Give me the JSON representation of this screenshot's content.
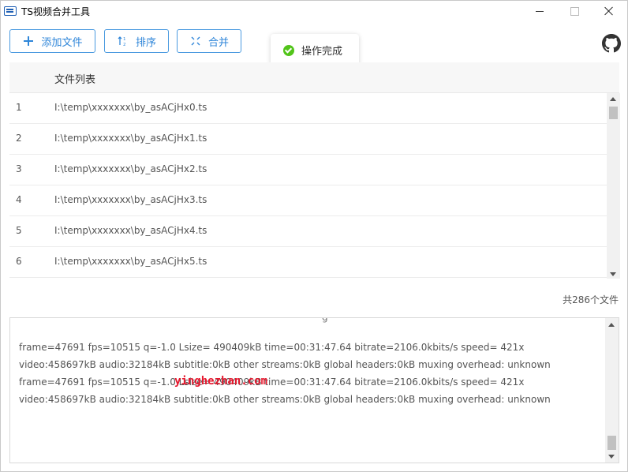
{
  "window": {
    "title": "TS视频合并工具"
  },
  "toolbar": {
    "add_label": "添加文件",
    "sort_label": "排序",
    "merge_label": "合并"
  },
  "toast": {
    "message": "操作完成"
  },
  "table": {
    "column_header": "文件列表",
    "rows": [
      {
        "index": "1",
        "path": "I:\\temp\\xxxxxxx\\by_asACjHx0.ts"
      },
      {
        "index": "2",
        "path": "I:\\temp\\xxxxxxx\\by_asACjHx1.ts"
      },
      {
        "index": "3",
        "path": "I:\\temp\\xxxxxxx\\by_asACjHx2.ts"
      },
      {
        "index": "4",
        "path": "I:\\temp\\xxxxxxx\\by_asACjHx3.ts"
      },
      {
        "index": "5",
        "path": "I:\\temp\\xxxxxxx\\by_asACjHx4.ts"
      },
      {
        "index": "6",
        "path": "I:\\temp\\xxxxxxx\\by_asACjHx5.ts"
      }
    ]
  },
  "file_count": "共286个文件",
  "log": {
    "lines": [
      "frame=47691 fps=10515 q=-1.0 Lsize=  490409kB time=00:31:47.64 bitrate=2106.0kbits/s speed= 421x",
      "video:458697kB audio:32184kB subtitle:0kB other streams:0kB global headers:0kB muxing overhead: unknown",
      "frame=47691 fps=10515 q=-1.0 Lsize=  490409kB time=00:31:47.64 bitrate=2106.0kbits/s speed= 421x",
      "video:458697kB audio:32184kB subtitle:0kB other streams:0kB global headers:0kB muxing overhead: unknown"
    ]
  },
  "watermark": "yinghezhan.com",
  "colors": {
    "accent": "#2f86d9",
    "success": "#52c41a",
    "watermark": "#e6172d"
  },
  "icons": [
    "app-icon",
    "plus-icon",
    "sort-icon",
    "merge-icon",
    "check-circle-icon",
    "github-icon",
    "minimize-icon",
    "maximize-icon",
    "close-icon"
  ]
}
